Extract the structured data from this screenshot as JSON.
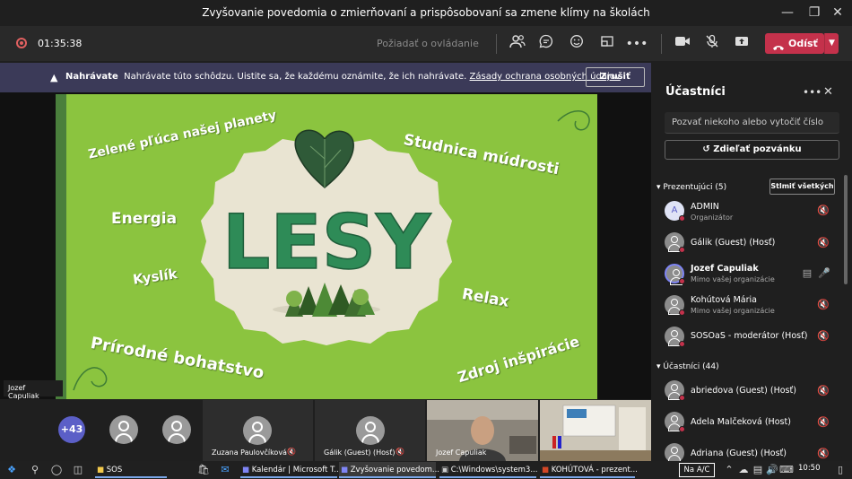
{
  "window": {
    "title": "Zvyšovanie povedomia o zmierňovaní a prispôsobovaní sa zmene klímy na školách",
    "minimize_icon": "minimize-icon",
    "maximize_icon": "maximize-icon",
    "close_icon": "close-icon"
  },
  "toolbar": {
    "timer": "01:35:38",
    "request_control": "Požiadať o ovládanie",
    "leave_label": "Odísť"
  },
  "banner": {
    "prefix": "Nahrávate",
    "text": "Nahrávate túto schôdzu. Uistite sa, že každému oznámite, že ich nahrávate.",
    "link": "Zásady ochrana osobných údajov",
    "stop_label": "Zrušiť"
  },
  "slide": {
    "title": "LESY",
    "phrases": {
      "top_left": "Zelené pľúca našej planety",
      "top_right": "Studnica múdrosti",
      "energy": "Energia",
      "oxygen": "Kyslík",
      "relax": "Relax",
      "bottom_left": "Prírodné bohatstvo",
      "bottom_right": "Zdroj inšpirácie"
    },
    "colors": {
      "background": "#8bc43f",
      "badge": "#e9e4d2",
      "title": "#2e8b57"
    }
  },
  "stage": {
    "presenter_label": "Jozef Capuliak"
  },
  "strip": {
    "more_count": "+43",
    "tiles": [
      {
        "name": "Zuzana Paulovčíková"
      },
      {
        "name": "Gálik (Guest) (Hosť)"
      },
      {
        "name": "Jozef Capuliak"
      }
    ]
  },
  "panel": {
    "title": "Účastníci",
    "search_placeholder": "Pozvať niekoho alebo vytočiť číslo",
    "share_label": "Zdieľať pozvánku",
    "presenters_label": "Prezentujúci (5)",
    "mute_all_label": "Stlmiť všetkých",
    "attendees_label": "Účastníci (44)",
    "presenters": [
      {
        "initial": "A",
        "name": "ADMIN",
        "sub": "Organizátor"
      },
      {
        "name": "Gálik (Guest) (Hosť)",
        "sub": ""
      },
      {
        "name": "Jozef Capuliak",
        "sub": "Mimo vašej organizácie"
      },
      {
        "name": "Kohútová Mária",
        "sub": "Mimo vašej organizácie"
      },
      {
        "name": "SOSOaS - moderátor (Hosť)",
        "sub": ""
      }
    ],
    "attendees": [
      {
        "name": "abriedova (Guest) (Hosť)"
      },
      {
        "name": "Adela Malčeková (Host)"
      },
      {
        "name": "Adriana (Guest) (Hosť)"
      }
    ]
  },
  "taskbar": {
    "tasks": [
      {
        "label": "SOS"
      },
      {
        "label": "Kalendár | Microsoft T..."
      },
      {
        "label": "Zvyšovanie povedom..."
      },
      {
        "label": "C:\\Windows\\system3..."
      },
      {
        "label": "KOHÚTOVÁ - prezent..."
      }
    ],
    "lang": "Na A/C",
    "time": "10:50"
  }
}
